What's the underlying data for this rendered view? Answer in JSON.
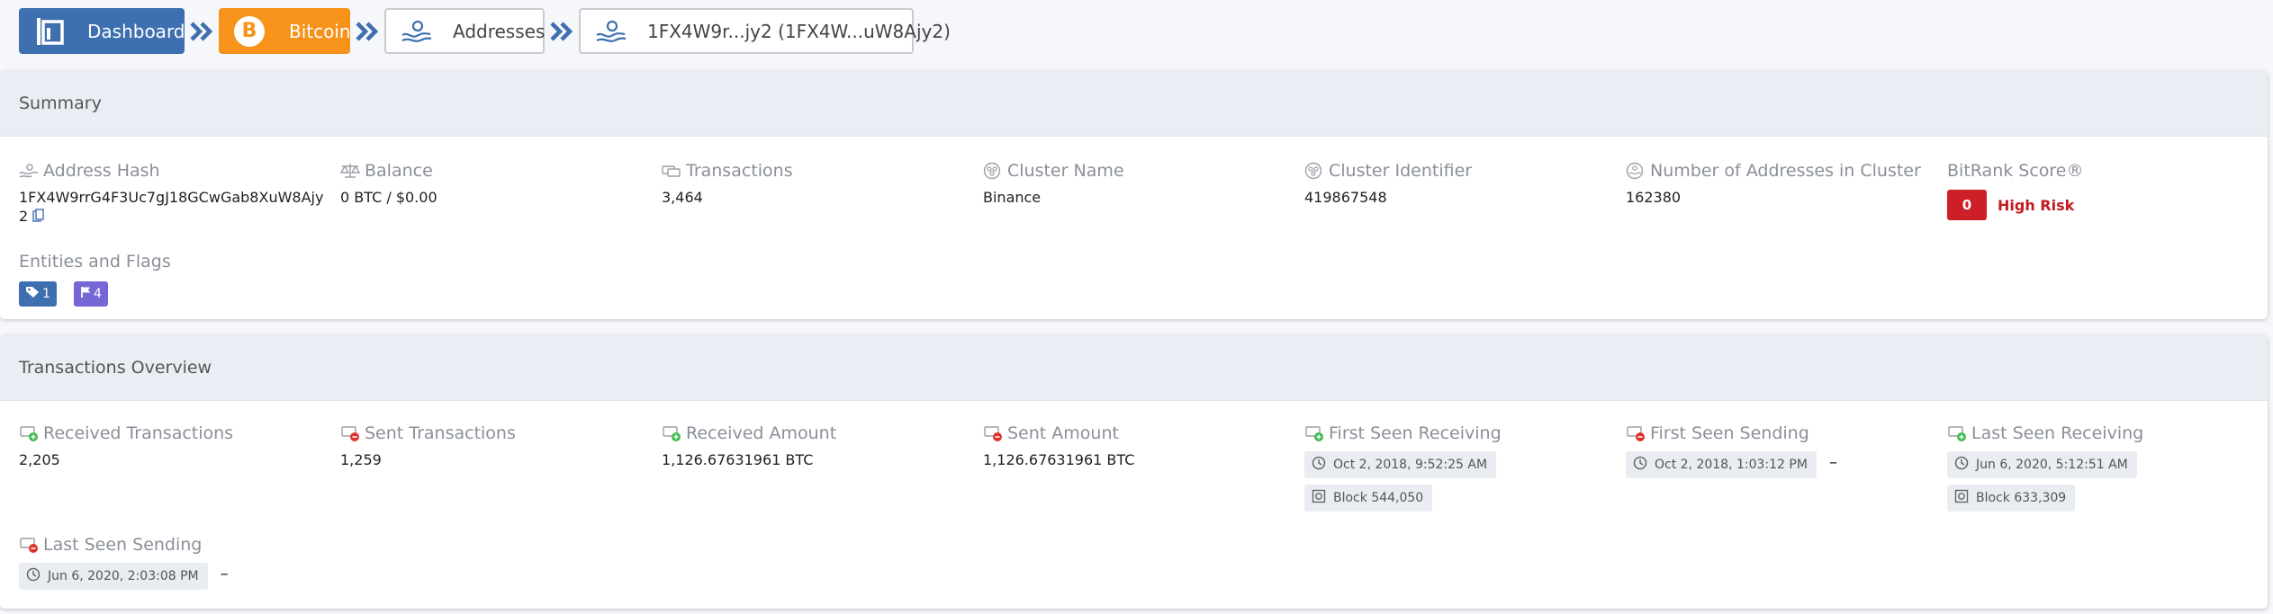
{
  "breadcrumb": {
    "dashboard": "Dashboard",
    "bitcoin": "Bitcoin",
    "addresses": "Addresses",
    "current": "1FX4W9r...jy2 (1FX4W...uW8Ajy2)"
  },
  "summary": {
    "title": "Summary",
    "address_hash": {
      "label": "Address Hash",
      "value_line1": "1FX4W9rrG4F3Uc7gJ18GCwGab8XuW8Ajy",
      "value_line2": "2"
    },
    "balance": {
      "label": "Balance",
      "value": "0 BTC / $0.00"
    },
    "transactions": {
      "label": "Transactions",
      "value": "3,464"
    },
    "cluster_name": {
      "label": "Cluster Name",
      "value": "Binance"
    },
    "cluster_identifier": {
      "label": "Cluster Identifier",
      "value": "419867548"
    },
    "addresses_in_cluster": {
      "label": "Number of Addresses in Cluster",
      "value": "162380"
    },
    "bitrank": {
      "label": "BitRank Score®",
      "score": "0",
      "risk": "High Risk"
    },
    "entities": {
      "label": "Entities and Flags",
      "tags_count": "1",
      "flags_count": "4"
    }
  },
  "overview": {
    "title": "Transactions Overview",
    "received_tx": {
      "label": "Received Transactions",
      "value": "2,205"
    },
    "sent_tx": {
      "label": "Sent Transactions",
      "value": "1,259"
    },
    "received_amount": {
      "label": "Received Amount",
      "value": "1,126.67631961 BTC"
    },
    "sent_amount": {
      "label": "Sent Amount",
      "value": "1,126.67631961 BTC"
    },
    "first_seen_receiving": {
      "label": "First Seen Receiving",
      "time": "Oct 2, 2018, 9:52:25 AM",
      "block": "Block 544,050"
    },
    "first_seen_sending": {
      "label": "First Seen Sending",
      "time": "Oct 2, 2018, 1:03:12 PM",
      "dash": "–"
    },
    "last_seen_receiving": {
      "label": "Last Seen Receiving",
      "time": "Jun 6, 2020, 5:12:51 AM",
      "block": "Block 633,309"
    },
    "last_seen_sending": {
      "label": "Last Seen Sending",
      "time": "Jun 6, 2020, 2:03:08 PM",
      "dash": "–"
    }
  },
  "colors": {
    "dashboard": "#3e6fb0",
    "bitcoin": "#f7931a",
    "risk": "#cc1f28",
    "flag_chip": "#7667d6"
  },
  "icons": {
    "dashboard": "dashboard-icon",
    "bitcoin": "bitcoin-icon",
    "address": "address-hand-icon",
    "copy": "copy-icon",
    "clock": "clock-icon",
    "block": "block-icon",
    "tag": "tag-icon",
    "flag": "flag-icon"
  }
}
